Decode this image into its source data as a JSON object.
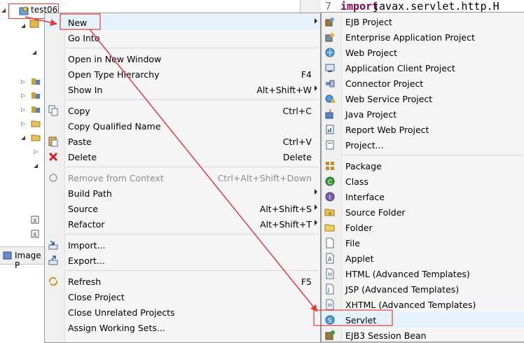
{
  "project_explorer": {
    "project_name": "test06",
    "image_tab_label": "Image P"
  },
  "editor": {
    "line_number": "7",
    "keyword": "import",
    "code": "javax.servlet.http.H"
  },
  "context_menu": {
    "items": [
      {
        "label": "New",
        "submenu": true
      },
      {
        "label": "Go Into"
      },
      {
        "label": "Open in New Window"
      },
      {
        "label": "Open Type Hierarchy",
        "shortcut": "F4"
      },
      {
        "label": "Show In",
        "shortcut": "Alt+Shift+W",
        "submenu": true
      },
      {
        "label": "Copy",
        "shortcut": "Ctrl+C",
        "icon": "copy-icon"
      },
      {
        "label": "Copy Qualified Name"
      },
      {
        "label": "Paste",
        "shortcut": "Ctrl+V",
        "icon": "paste-icon"
      },
      {
        "label": "Delete",
        "shortcut": "Delete",
        "icon": "delete-icon"
      },
      {
        "label": "Remove from Context",
        "shortcut": "Ctrl+Alt+Shift+Down",
        "disabled": true,
        "icon": "remove-context-icon"
      },
      {
        "label": "Build Path",
        "submenu": true
      },
      {
        "label": "Source",
        "shortcut": "Alt+Shift+S",
        "submenu": true
      },
      {
        "label": "Refactor",
        "shortcut": "Alt+Shift+T",
        "submenu": true
      },
      {
        "label": "Import...",
        "icon": "import-icon"
      },
      {
        "label": "Export...",
        "icon": "export-icon"
      },
      {
        "label": "Refresh",
        "shortcut": "F5",
        "icon": "refresh-icon"
      },
      {
        "label": "Close Project"
      },
      {
        "label": "Close Unrelated Projects"
      },
      {
        "label": "Assign Working Sets..."
      }
    ]
  },
  "new_submenu": {
    "items": [
      {
        "label": "EJB Project",
        "icon": "ejb-project-icon"
      },
      {
        "label": "Enterprise Application Project",
        "icon": "enterprise-app-icon"
      },
      {
        "label": "Web Project",
        "icon": "web-project-icon"
      },
      {
        "label": "Application Client Project",
        "icon": "app-client-icon"
      },
      {
        "label": "Connector Project",
        "icon": "connector-icon"
      },
      {
        "label": "Web Service Project",
        "icon": "web-service-icon"
      },
      {
        "label": "Java Project",
        "icon": "java-project-icon"
      },
      {
        "label": "Report Web Project",
        "icon": "report-web-icon"
      },
      {
        "label": "Project...",
        "icon": "project-icon"
      },
      {
        "label": "Package",
        "icon": "package-icon"
      },
      {
        "label": "Class",
        "icon": "class-icon"
      },
      {
        "label": "Interface",
        "icon": "interface-icon"
      },
      {
        "label": "Source Folder",
        "icon": "source-folder-icon"
      },
      {
        "label": "Folder",
        "icon": "folder-icon"
      },
      {
        "label": "File",
        "icon": "file-icon"
      },
      {
        "label": "Applet",
        "icon": "applet-icon"
      },
      {
        "label": "HTML (Advanced Templates)",
        "icon": "html-icon"
      },
      {
        "label": "JSP (Advanced Templates)",
        "icon": "jsp-icon"
      },
      {
        "label": "XHTML (Advanced Templates)",
        "icon": "xhtml-icon"
      },
      {
        "label": "Servlet",
        "icon": "servlet-icon"
      },
      {
        "label": "EJB3 Session Bean",
        "icon": "ejb3-bean-icon"
      }
    ]
  },
  "colors": {
    "annotation_red": "#e23c3c",
    "menu_bg": "#f5f5f5",
    "keyword": "#7f0055"
  }
}
